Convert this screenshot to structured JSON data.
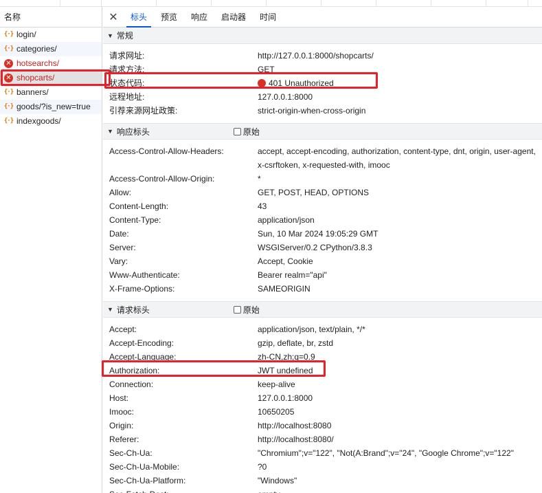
{
  "request_list": {
    "header": "名称",
    "items": [
      {
        "name": "login/",
        "status": "ok"
      },
      {
        "name": "categories/",
        "status": "ok"
      },
      {
        "name": "hotsearchs/",
        "status": "error"
      },
      {
        "name": "shopcarts/",
        "status": "error",
        "selected": true
      },
      {
        "name": "banners/",
        "status": "ok"
      },
      {
        "name": "goods/?is_new=true",
        "status": "ok"
      },
      {
        "name": "indexgoods/",
        "status": "ok"
      }
    ]
  },
  "tabs": {
    "close": "✕",
    "items": [
      "标头",
      "预览",
      "响应",
      "启动器",
      "时间"
    ],
    "active": "标头"
  },
  "general": {
    "title": "常规",
    "rows": [
      {
        "key": "请求网址:",
        "value": "http://127.0.0.1:8000/shopcarts/"
      },
      {
        "key": "请求方法:",
        "value": "GET"
      },
      {
        "key": "状态代码:",
        "value": "401 Unauthorized"
      },
      {
        "key": "远程地址:",
        "value": "127.0.0.1:8000"
      },
      {
        "key": "引荐来源网址政策:",
        "value": "strict-origin-when-cross-origin"
      }
    ]
  },
  "response_headers": {
    "title": "响应标头",
    "raw_label": "原始",
    "rows": [
      {
        "key": "Access-Control-Allow-Headers:",
        "value": "accept, accept-encoding, authorization, content-type, dnt, origin, user-agent, x-csrftoken, x-requested-with, imooc"
      },
      {
        "key": "Access-Control-Allow-Origin:",
        "value": "*"
      },
      {
        "key": "Allow:",
        "value": "GET, POST, HEAD, OPTIONS"
      },
      {
        "key": "Content-Length:",
        "value": "43"
      },
      {
        "key": "Content-Type:",
        "value": "application/json"
      },
      {
        "key": "Date:",
        "value": "Sun, 10 Mar 2024 19:05:29 GMT"
      },
      {
        "key": "Server:",
        "value": "WSGIServer/0.2 CPython/3.8.3"
      },
      {
        "key": "Vary:",
        "value": "Accept, Cookie"
      },
      {
        "key": "Www-Authenticate:",
        "value": "Bearer realm=\"api\""
      },
      {
        "key": "X-Frame-Options:",
        "value": "SAMEORIGIN"
      }
    ]
  },
  "request_headers": {
    "title": "请求标头",
    "raw_label": "原始",
    "rows": [
      {
        "key": "Accept:",
        "value": "application/json, text/plain, */*"
      },
      {
        "key": "Accept-Encoding:",
        "value": "gzip, deflate, br, zstd"
      },
      {
        "key": "Accept-Language:",
        "value": "zh-CN,zh;q=0.9"
      },
      {
        "key": "Authorization:",
        "value": "JWT undefined"
      },
      {
        "key": "Connection:",
        "value": "keep-alive"
      },
      {
        "key": "Host:",
        "value": "127.0.0.1:8000"
      },
      {
        "key": "Imooc:",
        "value": "10650205"
      },
      {
        "key": "Origin:",
        "value": "http://localhost:8080"
      },
      {
        "key": "Referer:",
        "value": "http://localhost:8080/"
      },
      {
        "key": "Sec-Ch-Ua:",
        "value": "\"Chromium\";v=\"122\", \"Not(A:Brand\";v=\"24\", \"Google Chrome\";v=\"122\""
      },
      {
        "key": "Sec-Ch-Ua-Mobile:",
        "value": "?0"
      },
      {
        "key": "Sec-Ch-Ua-Platform:",
        "value": "\"Windows\""
      },
      {
        "key": "Sec-Fetch-Dest:",
        "value": "empty"
      }
    ]
  },
  "colors": {
    "accent": "#0b57d0",
    "error": "#d93025",
    "highlight": "#e8202a"
  }
}
